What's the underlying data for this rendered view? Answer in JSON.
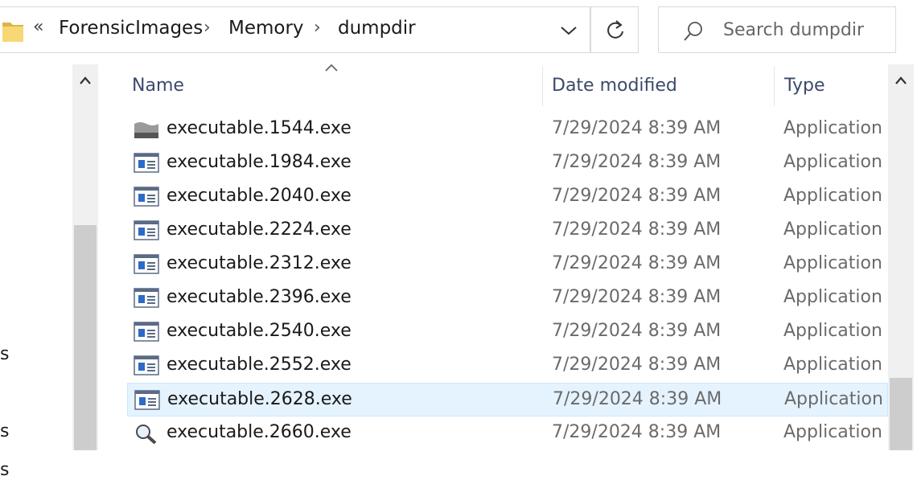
{
  "address_bar": {
    "overflow_glyph": "«",
    "breadcrumbs": [
      "ForensicImages",
      "Memory",
      "dumpdir"
    ],
    "separator": "›"
  },
  "search": {
    "placeholder": "Search dumpdir",
    "value": ""
  },
  "nav_pane": {
    "clipped_labels": [
      "s",
      "s",
      "s"
    ]
  },
  "columns": {
    "name": "Name",
    "date_modified": "Date modified",
    "type": "Type"
  },
  "files": [
    {
      "name": "executable.1544.exe",
      "date": "7/29/2024 8:39 AM",
      "type": "Application",
      "icon": "generic-app-icon",
      "selected": false
    },
    {
      "name": "executable.1984.exe",
      "date": "7/29/2024 8:39 AM",
      "type": "Application",
      "icon": "window-app-icon",
      "selected": false
    },
    {
      "name": "executable.2040.exe",
      "date": "7/29/2024 8:39 AM",
      "type": "Application",
      "icon": "window-app-icon",
      "selected": false
    },
    {
      "name": "executable.2224.exe",
      "date": "7/29/2024 8:39 AM",
      "type": "Application",
      "icon": "window-app-icon",
      "selected": false
    },
    {
      "name": "executable.2312.exe",
      "date": "7/29/2024 8:39 AM",
      "type": "Application",
      "icon": "window-app-icon",
      "selected": false
    },
    {
      "name": "executable.2396.exe",
      "date": "7/29/2024 8:39 AM",
      "type": "Application",
      "icon": "window-app-icon",
      "selected": false
    },
    {
      "name": "executable.2540.exe",
      "date": "7/29/2024 8:39 AM",
      "type": "Application",
      "icon": "window-app-icon",
      "selected": false
    },
    {
      "name": "executable.2552.exe",
      "date": "7/29/2024 8:39 AM",
      "type": "Application",
      "icon": "window-app-icon",
      "selected": false
    },
    {
      "name": "executable.2628.exe",
      "date": "7/29/2024 8:39 AM",
      "type": "Application",
      "icon": "window-app-icon",
      "selected": true
    },
    {
      "name": "executable.2660.exe",
      "date": "7/29/2024 8:39 AM",
      "type": "Application",
      "icon": "magnifier-app-icon",
      "selected": false
    }
  ],
  "colors": {
    "selected_row": "#e5f3ff",
    "header_text": "#3b4a6b",
    "folder": "#f8d775"
  }
}
